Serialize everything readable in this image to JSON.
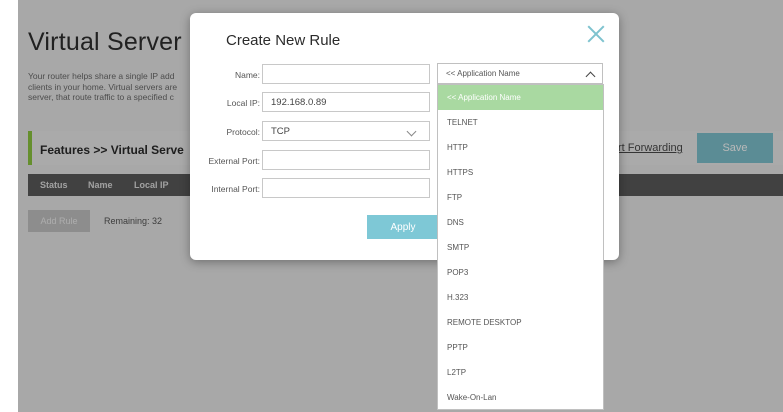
{
  "background": {
    "page_title": "Virtual Server",
    "description": "Your router helps share a single IP address assigned by your Internet service provider among several clients in your home. Virtual servers are preset port rules for the most common applications. When you create a virtual server, that route traffic to a specified computer...",
    "description_visible": [
      "Your router helps share a single IP add",
      "clients in your home. Virtual servers are",
      "server, that route traffic to a specified c"
    ],
    "features_label": "Features >> Virtual Serve",
    "port_forwarding_link": "rt Forwarding",
    "save_label": "Save",
    "table_headers": [
      "Status",
      "Name",
      "Local IP"
    ],
    "add_rule_label": "Add Rule",
    "remaining_text": "Remaining: 32",
    "accent_color": "#8cc63f"
  },
  "modal": {
    "title": "Create New Rule",
    "close_icon": "close-icon",
    "fields": {
      "name_label": "Name:",
      "name_value": "",
      "local_ip_label": "Local IP:",
      "local_ip_value": "192.168.0.89",
      "protocol_label": "Protocol:",
      "protocol_value": "TCP",
      "external_port_label": "External Port:",
      "external_port_value": "",
      "internal_port_label": "Internal Port:",
      "internal_port_value": ""
    },
    "apply_label": "Apply"
  },
  "application_select": {
    "selected": "<< Application Name",
    "options": [
      "<< Application Name",
      "TELNET",
      "HTTP",
      "HTTPS",
      "FTP",
      "DNS",
      "SMTP",
      "POP3",
      "H.323",
      "REMOTE DESKTOP",
      "PPTP",
      "L2TP",
      "Wake-On-Lan"
    ],
    "highlight_color": "#a9d9a1"
  }
}
